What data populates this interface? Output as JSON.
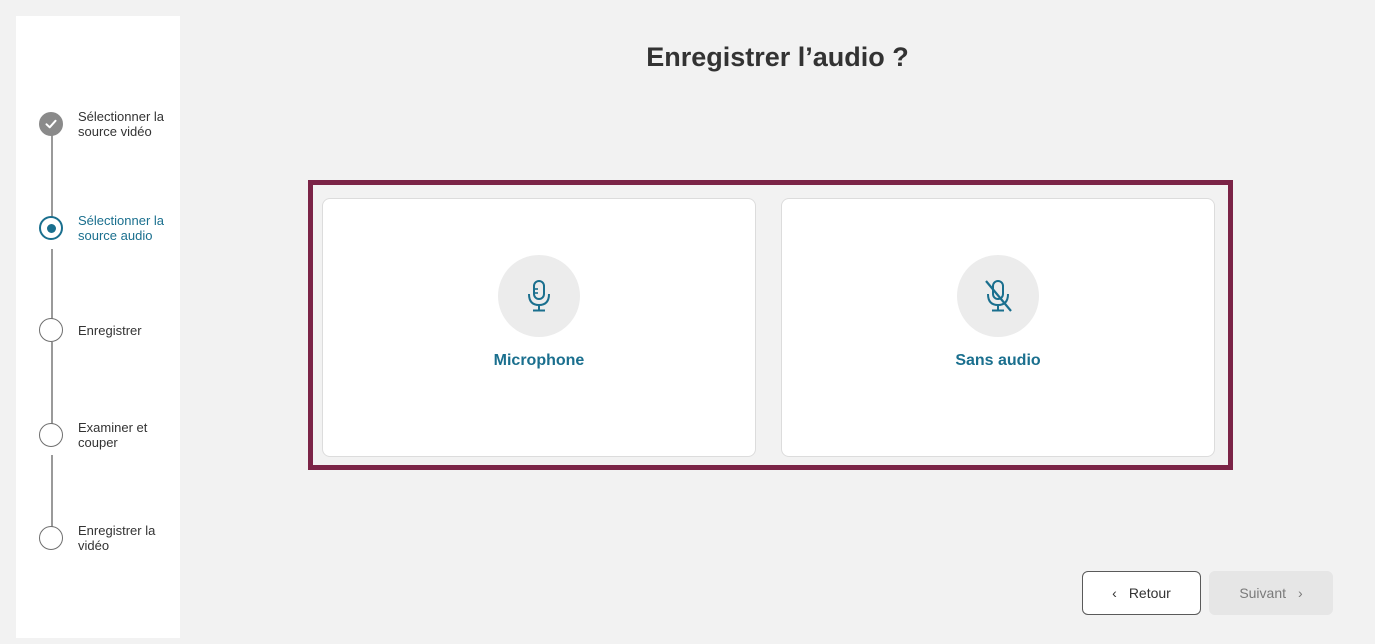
{
  "title": "Enregistrer l’audio ?",
  "steps": [
    {
      "label": "Sélectionner la source vidéo",
      "state": "done"
    },
    {
      "label": "Sélectionner la source audio",
      "state": "current"
    },
    {
      "label": "Enregistrer",
      "state": "pending"
    },
    {
      "label": "Examiner et couper",
      "state": "pending"
    },
    {
      "label": "Enregistrer la vidéo",
      "state": "pending"
    }
  ],
  "options": [
    {
      "label": "Microphone",
      "icon": "microphone-icon"
    },
    {
      "label": "Sans audio",
      "icon": "microphone-off-icon"
    }
  ],
  "nav": {
    "back_label": "Retour",
    "next_label": "Suivant",
    "back_icon": "chevron-left-icon",
    "next_icon": "chevron-right-icon"
  },
  "colors": {
    "accent": "#1a6f8e",
    "frame": "#7b2447",
    "done": "#8a8a8a"
  }
}
